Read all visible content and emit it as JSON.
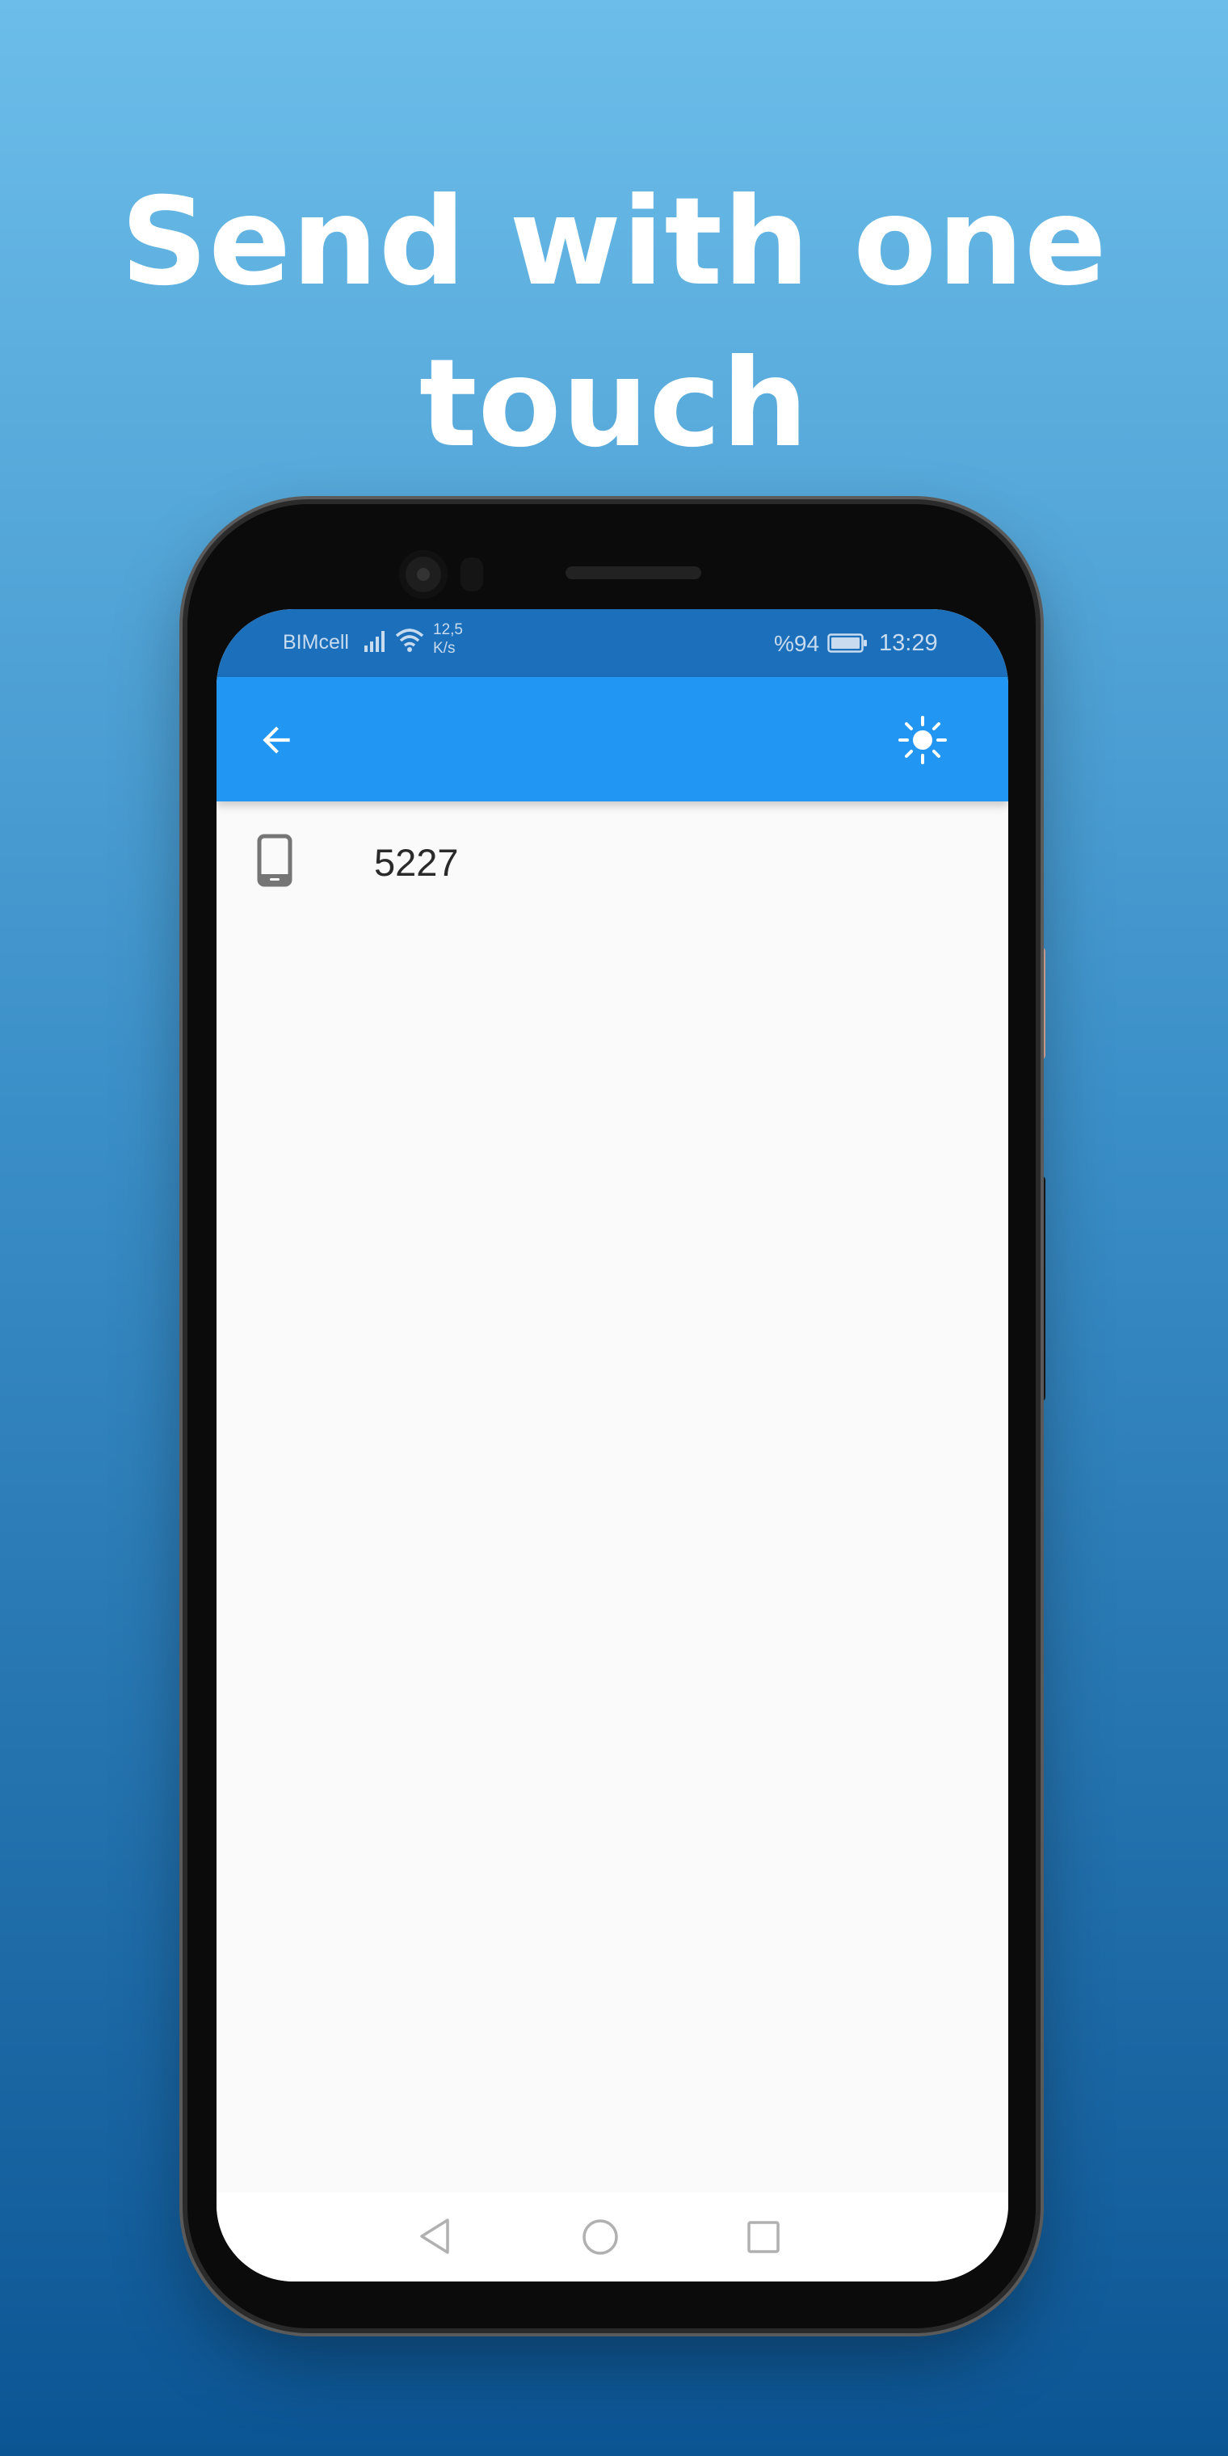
{
  "headline": "Send with one touch",
  "status_bar": {
    "carrier": "BIMcell",
    "net_speed_value": "12,5",
    "net_speed_unit": "K/s",
    "battery_percent": "%94",
    "time": "13:29",
    "icons": [
      "signal-icon",
      "wifi-icon",
      "battery-icon"
    ]
  },
  "app_bar": {
    "back_icon": "arrow-back-icon",
    "action_icon": "brightness-icon"
  },
  "list": {
    "items": [
      {
        "icon": "smartphone-icon",
        "label": "5227"
      }
    ]
  },
  "nav_bar": {
    "icons": [
      "nav-back-icon",
      "nav-home-icon",
      "nav-recent-icon"
    ]
  },
  "colors": {
    "app_bar": "#2196f3",
    "status_bar": "#1c6fbb",
    "background_top": "#6cbde9",
    "background_bottom": "#0c5594",
    "screen": "#fafafa"
  }
}
